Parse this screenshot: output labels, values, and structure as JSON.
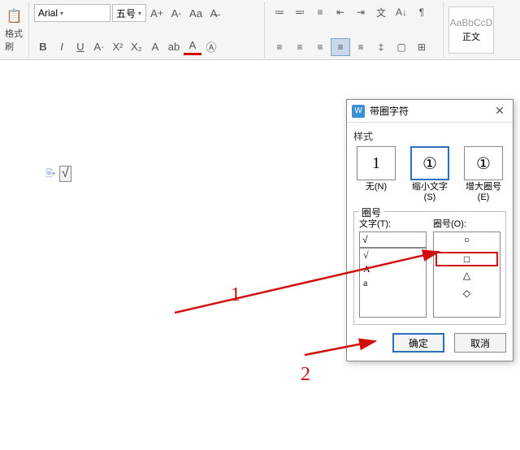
{
  "ribbon": {
    "format_painter": "格式刷",
    "font_name": "Arial",
    "font_size": "五号",
    "bold": "B",
    "italic": "I",
    "underline": "U",
    "strike": "A",
    "style": {
      "sample": "AaBbCcD",
      "label": "正文"
    }
  },
  "doc": {
    "inserted_char": "√"
  },
  "dialog": {
    "title": "带圈字符",
    "section_style": "样式",
    "styles": [
      {
        "preview": "1",
        "label": "无(N)"
      },
      {
        "preview": "①",
        "label": "缩小文字(S)"
      },
      {
        "preview": "①",
        "label": "增大圈号(E)"
      }
    ],
    "section_circle": "圈号",
    "text_label": "文字(T):",
    "circle_label": "圈号(O):",
    "text_value": "√",
    "text_options": [
      "√",
      "A",
      "a"
    ],
    "circle_options": [
      "○",
      "□",
      "△",
      "◇"
    ],
    "ok": "确定",
    "cancel": "取消"
  },
  "annotations": {
    "one": "1",
    "two": "2"
  }
}
